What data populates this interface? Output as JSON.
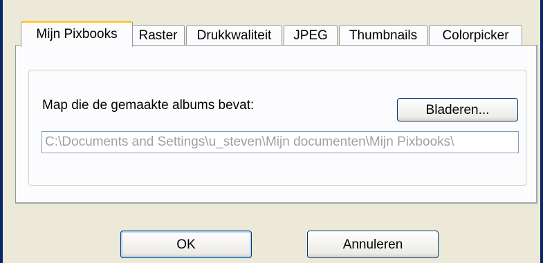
{
  "tabs": [
    {
      "label": "Mijn Pixbooks",
      "active": true
    },
    {
      "label": "Raster",
      "active": false
    },
    {
      "label": "Drukkwaliteit",
      "active": false
    },
    {
      "label": "JPEG",
      "active": false
    },
    {
      "label": "Thumbnails",
      "active": false
    },
    {
      "label": "Colorpicker",
      "active": false
    }
  ],
  "panel": {
    "folder_label": "Map die de gemaakte albums bevat:",
    "browse_label": "Bladeren...",
    "path_value": "C:\\Documents and Settings\\u_steven\\Mijn documenten\\Mijn Pixbooks\\"
  },
  "footer": {
    "ok_label": "OK",
    "cancel_label": "Annuleren"
  }
}
